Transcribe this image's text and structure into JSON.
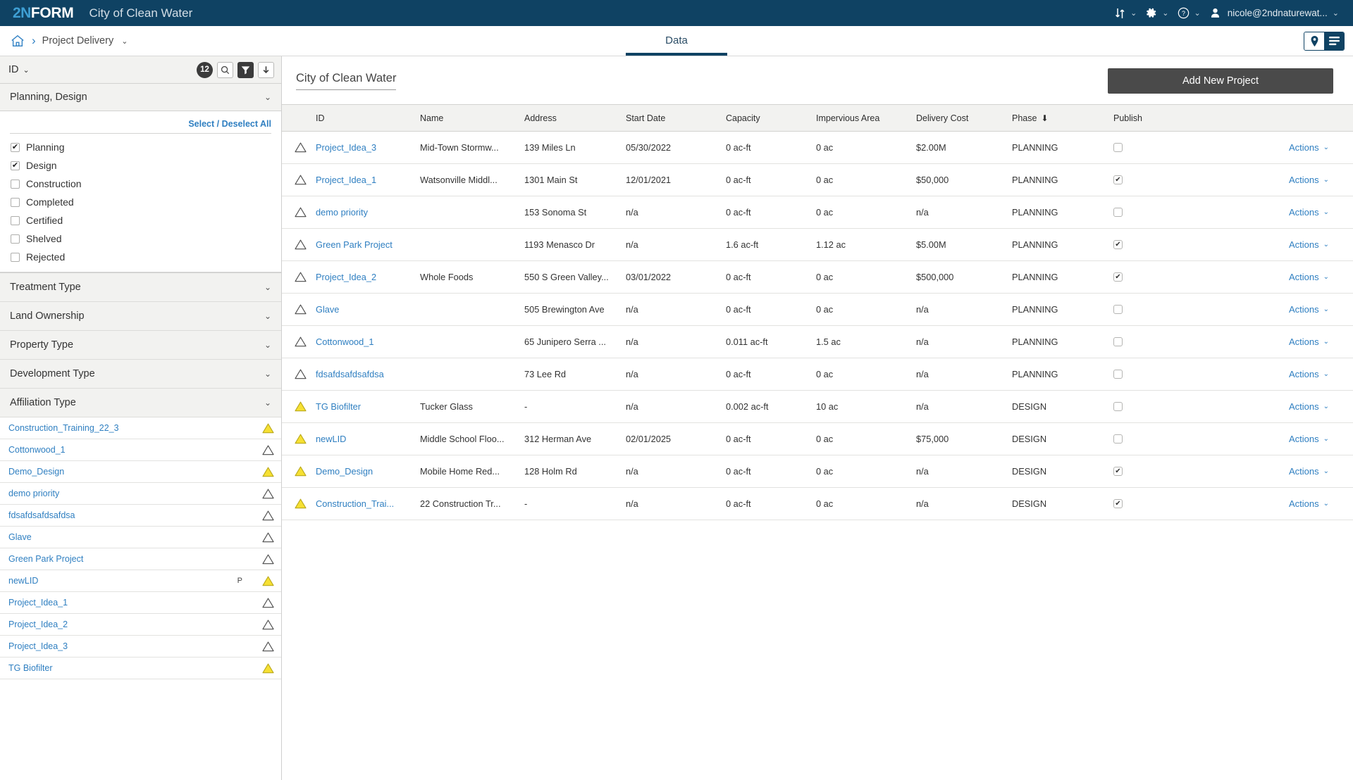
{
  "brand": {
    "logo_prefix": "2N",
    "logo_suffix": "FORM",
    "org_title": "City of Clean Water",
    "tools": {
      "sort_icon": "sort-arrows-icon",
      "settings_icon": "gear-icon",
      "help_icon": "question-circle-icon",
      "avatar_icon": "user-avatar-icon",
      "user_email": "nicole@2ndnaturewat...",
      "caret": "⌄"
    }
  },
  "nav": {
    "home_icon": "home-icon",
    "separator": "›",
    "breadcrumb_label": "Project Delivery",
    "breadcrumb_caret": "⌄",
    "tabs": [
      {
        "label": "Data",
        "active": true
      }
    ],
    "view_toggle": {
      "map_icon": "map-pin-icon",
      "list_icon": "list-view-icon",
      "active": "list"
    }
  },
  "sidebar": {
    "toolbar": {
      "sort_label": "ID",
      "sort_caret": "⌄",
      "count": "12",
      "search_icon": "search-icon",
      "filter_icon": "filter-funnel-icon",
      "download_icon": "download-arrow-icon"
    },
    "phase_section": {
      "header": "Planning, Design",
      "caret": "⌄",
      "select_deselect": "Select / Deselect All",
      "options": [
        {
          "label": "Planning",
          "checked": true
        },
        {
          "label": "Design",
          "checked": true
        },
        {
          "label": "Construction",
          "checked": false
        },
        {
          "label": "Completed",
          "checked": false
        },
        {
          "label": "Certified",
          "checked": false
        },
        {
          "label": "Shelved",
          "checked": false
        },
        {
          "label": "Rejected",
          "checked": false
        }
      ]
    },
    "filter_groups": [
      {
        "label": "Treatment Type",
        "caret": "⌄"
      },
      {
        "label": "Land Ownership",
        "caret": "⌄"
      },
      {
        "label": "Property Type",
        "caret": "⌄"
      },
      {
        "label": "Development Type",
        "caret": "⌄"
      },
      {
        "label": "Affiliation Type",
        "caret": "⌄"
      }
    ],
    "projects": [
      {
        "name": "Construction_Training_22_3",
        "flag": "",
        "triangle": "filled"
      },
      {
        "name": "Cottonwood_1",
        "flag": "",
        "triangle": "outline"
      },
      {
        "name": "Demo_Design",
        "flag": "",
        "triangle": "filled"
      },
      {
        "name": "demo priority",
        "flag": "",
        "triangle": "outline"
      },
      {
        "name": "fdsafdsafdsafdsa",
        "flag": "",
        "triangle": "outline"
      },
      {
        "name": "Glave",
        "flag": "",
        "triangle": "outline"
      },
      {
        "name": "Green Park Project",
        "flag": "",
        "triangle": "outline"
      },
      {
        "name": "newLID",
        "flag": "P",
        "triangle": "filled"
      },
      {
        "name": "Project_Idea_1",
        "flag": "",
        "triangle": "outline"
      },
      {
        "name": "Project_Idea_2",
        "flag": "",
        "triangle": "outline"
      },
      {
        "name": "Project_Idea_3",
        "flag": "",
        "triangle": "outline"
      },
      {
        "name": "TG Biofilter",
        "flag": "",
        "triangle": "filled"
      }
    ]
  },
  "main": {
    "page_title": "City of Clean Water",
    "add_button": "Add New Project",
    "columns": [
      {
        "key": "flag",
        "label": ""
      },
      {
        "key": "id",
        "label": "ID"
      },
      {
        "key": "name",
        "label": "Name"
      },
      {
        "key": "addr",
        "label": "Address"
      },
      {
        "key": "date",
        "label": "Start Date"
      },
      {
        "key": "cap",
        "label": "Capacity"
      },
      {
        "key": "imp",
        "label": "Impervious Area"
      },
      {
        "key": "cost",
        "label": "Delivery Cost"
      },
      {
        "key": "phase",
        "label": "Phase",
        "sorted": "desc",
        "sort_glyph": "⬇"
      },
      {
        "key": "pub",
        "label": "Publish"
      },
      {
        "key": "act",
        "label": ""
      }
    ],
    "actions_label": "Actions",
    "actions_caret": "⌄",
    "rows": [
      {
        "triangle": "outline",
        "id": "Project_Idea_3",
        "name": "Mid-Town Stormw...",
        "addr": "139 Miles Ln",
        "date": "05/30/2022",
        "cap": "0 ac-ft",
        "imp": "0 ac",
        "cost": "$2.00M",
        "phase": "PLANNING",
        "publish": false
      },
      {
        "triangle": "outline",
        "id": "Project_Idea_1",
        "name": "Watsonville Middl...",
        "addr": "1301 Main St",
        "date": "12/01/2021",
        "cap": "0 ac-ft",
        "imp": "0 ac",
        "cost": "$50,000",
        "phase": "PLANNING",
        "publish": true
      },
      {
        "triangle": "outline",
        "id": "demo priority",
        "name": "",
        "addr": "153 Sonoma St",
        "date": "n/a",
        "cap": "0 ac-ft",
        "imp": "0 ac",
        "cost": "n/a",
        "phase": "PLANNING",
        "publish": false
      },
      {
        "triangle": "outline",
        "id": "Green Park Project",
        "name": "",
        "addr": "1193 Menasco Dr",
        "date": "n/a",
        "cap": "1.6 ac-ft",
        "imp": "1.12 ac",
        "cost": "$5.00M",
        "phase": "PLANNING",
        "publish": true
      },
      {
        "triangle": "outline",
        "id": "Project_Idea_2",
        "name": "Whole Foods",
        "addr": "550 S Green Valley...",
        "date": "03/01/2022",
        "cap": "0 ac-ft",
        "imp": "0 ac",
        "cost": "$500,000",
        "phase": "PLANNING",
        "publish": true
      },
      {
        "triangle": "outline",
        "id": "Glave",
        "name": "",
        "addr": "505 Brewington Ave",
        "date": "n/a",
        "cap": "0 ac-ft",
        "imp": "0 ac",
        "cost": "n/a",
        "phase": "PLANNING",
        "publish": false
      },
      {
        "triangle": "outline",
        "id": "Cottonwood_1",
        "name": "",
        "addr": "65 Junipero Serra ...",
        "date": "n/a",
        "cap": "0.011 ac-ft",
        "imp": "1.5 ac",
        "cost": "n/a",
        "phase": "PLANNING",
        "publish": false
      },
      {
        "triangle": "outline",
        "id": "fdsafdsafdsafdsa",
        "name": "",
        "addr": "73 Lee Rd",
        "date": "n/a",
        "cap": "0 ac-ft",
        "imp": "0 ac",
        "cost": "n/a",
        "phase": "PLANNING",
        "publish": false
      },
      {
        "triangle": "filled",
        "id": "TG Biofilter",
        "name": "Tucker Glass",
        "addr": "-",
        "date": "n/a",
        "cap": "0.002 ac-ft",
        "imp": "10 ac",
        "cost": "n/a",
        "phase": "DESIGN",
        "publish": false
      },
      {
        "triangle": "filled",
        "id": "newLID",
        "name": "Middle School Floo...",
        "addr": "312 Herman Ave",
        "date": "02/01/2025",
        "cap": "0 ac-ft",
        "imp": "0 ac",
        "cost": "$75,000",
        "phase": "DESIGN",
        "publish": false
      },
      {
        "triangle": "filled",
        "id": "Demo_Design",
        "name": "Mobile Home Red...",
        "addr": "128 Holm Rd",
        "date": "n/a",
        "cap": "0 ac-ft",
        "imp": "0 ac",
        "cost": "n/a",
        "phase": "DESIGN",
        "publish": true
      },
      {
        "triangle": "filled",
        "id": "Construction_Trai...",
        "name": "22 Construction Tr...",
        "addr": "-",
        "date": "n/a",
        "cap": "0 ac-ft",
        "imp": "0 ac",
        "cost": "n/a",
        "phase": "DESIGN",
        "publish": true
      }
    ]
  },
  "colors": {
    "brand_dark": "#0f4263",
    "brand_light_blue": "#3e9fd4",
    "link_blue": "#2f7fc1",
    "warning_yellow": "#f6e033",
    "button_gray": "#4a4a4a",
    "panel_gray": "#f2f2f0"
  }
}
